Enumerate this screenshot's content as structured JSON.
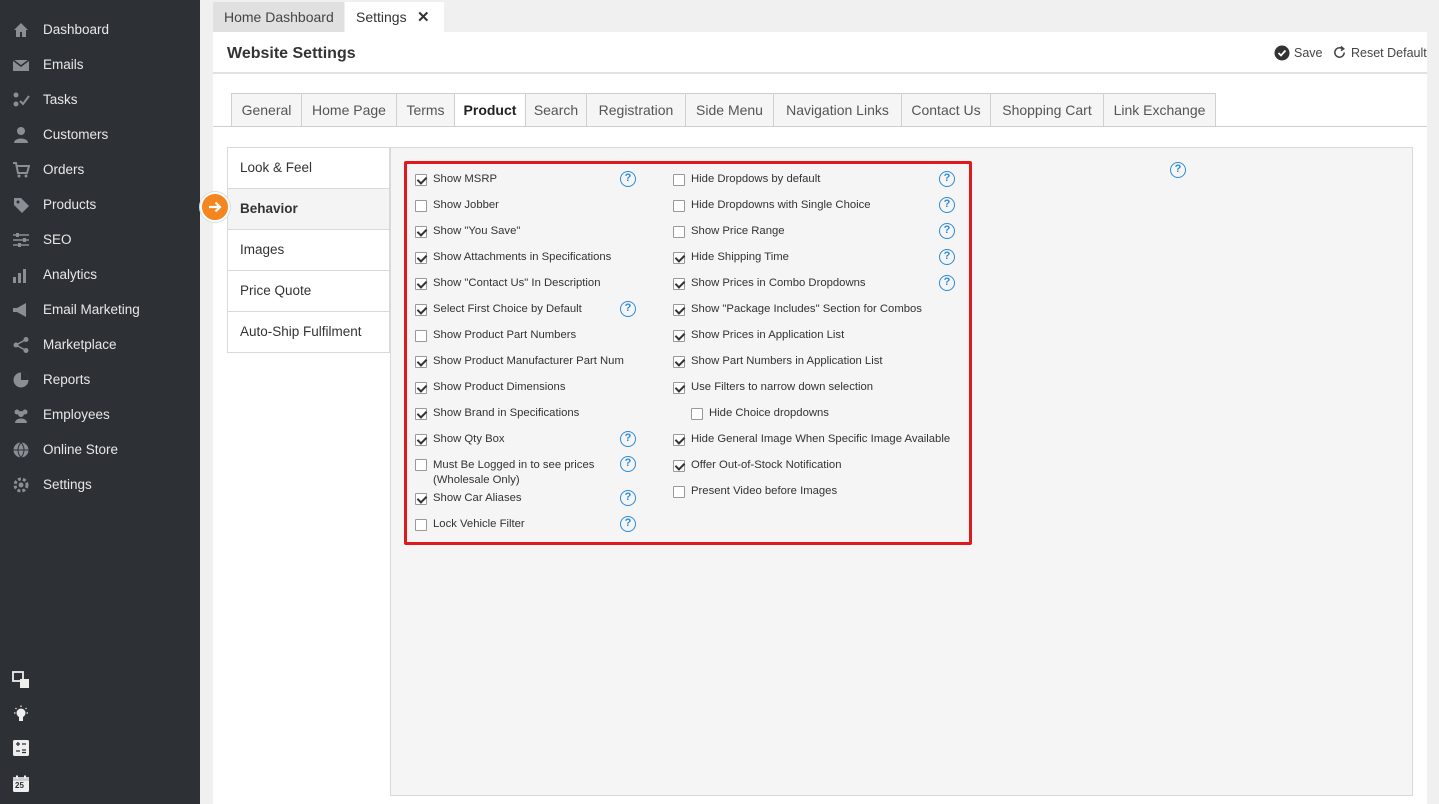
{
  "sidebar": {
    "items": [
      {
        "label": "Dashboard",
        "icon": "home-icon"
      },
      {
        "label": "Emails",
        "icon": "envelope-icon"
      },
      {
        "label": "Tasks",
        "icon": "tasks-icon"
      },
      {
        "label": "Customers",
        "icon": "user-icon"
      },
      {
        "label": "Orders",
        "icon": "cart-icon"
      },
      {
        "label": "Products",
        "icon": "tag-icon"
      },
      {
        "label": "SEO",
        "icon": "sliders-icon"
      },
      {
        "label": "Analytics",
        "icon": "bar-chart-icon"
      },
      {
        "label": "Email Marketing",
        "icon": "megaphone-icon"
      },
      {
        "label": "Marketplace",
        "icon": "share-icon"
      },
      {
        "label": "Reports",
        "icon": "pie-chart-icon"
      },
      {
        "label": "Employees",
        "icon": "users-icon"
      },
      {
        "label": "Online Store",
        "icon": "globe-icon"
      },
      {
        "label": "Settings",
        "icon": "gear-icon"
      }
    ],
    "tools": [
      "windows-icon",
      "lightbulb-icon",
      "calculator-icon",
      "calendar-icon"
    ],
    "calendar_day": "25"
  },
  "top_tabs": [
    {
      "label": "Home Dashboard"
    },
    {
      "label": "Settings",
      "close": "✕"
    }
  ],
  "header": {
    "title": "Website Settings",
    "save_label": "Save",
    "reset_label": "Reset Default"
  },
  "settings_tabs": [
    "General",
    "Home Page",
    "Terms",
    "Product",
    "Search",
    "Registration",
    "Side Menu",
    "Navigation Links",
    "Contact Us",
    "Shopping Cart",
    "Link Exchange"
  ],
  "active_settings_tab": "Product",
  "subnav": [
    "Look & Feel",
    "Behavior",
    "Images",
    "Price Quote",
    "Auto-Ship Fulfilment"
  ],
  "active_subnav": "Behavior",
  "help_glyph": "?",
  "left_options": [
    {
      "label": "Show MSRP",
      "checked": true,
      "help": true
    },
    {
      "label": "Show Jobber",
      "checked": false,
      "help": false
    },
    {
      "label": "Show \"You Save\"",
      "checked": true,
      "help": false
    },
    {
      "label": "Show Attachments in Specifications",
      "checked": true,
      "help": false
    },
    {
      "label": "Show \"Contact Us\" In Description",
      "checked": true,
      "help": false
    },
    {
      "label": "Select First Choice by Default",
      "checked": true,
      "help": true
    },
    {
      "label": "Show Product Part Numbers",
      "checked": false,
      "help": false
    },
    {
      "label": "Show Product Manufacturer Part Num",
      "checked": true,
      "help": false
    },
    {
      "label": "Show Product Dimensions",
      "checked": true,
      "help": false
    },
    {
      "label": "Show Brand in Specifications",
      "checked": true,
      "help": false
    },
    {
      "label": "Show Qty Box",
      "checked": true,
      "help": true
    },
    {
      "label": "Must Be Logged in to see prices",
      "label2": "(Wholesale Only)",
      "checked": false,
      "help": true
    },
    {
      "label": "Show Car Aliases",
      "checked": true,
      "help": true
    },
    {
      "label": "Lock Vehicle Filter",
      "checked": false,
      "help": true
    }
  ],
  "right_options": [
    {
      "label": "Hide Dropdows by default",
      "checked": false,
      "help": true
    },
    {
      "label": "Hide Dropdowns with Single Choice",
      "checked": false,
      "help": true
    },
    {
      "label": "Show Price Range",
      "checked": false,
      "help": true
    },
    {
      "label": "Hide Shipping Time",
      "checked": true,
      "help": true
    },
    {
      "label": "Show Prices in Combo Dropdowns",
      "checked": true,
      "help": true
    },
    {
      "label": "Show \"Package Includes\" Section for Combos",
      "checked": true,
      "help": false
    },
    {
      "label": "Show Prices in Application List",
      "checked": true,
      "help": false
    },
    {
      "label": "Show Part Numbers in Application List",
      "checked": true,
      "help": false
    },
    {
      "label": "Use Filters to narrow down selection",
      "checked": true,
      "help": false
    },
    {
      "label": "Hide Choice dropdowns",
      "checked": false,
      "help": false,
      "indent": true
    },
    {
      "label": "Hide General Image When Specific Image Available",
      "checked": true,
      "help": false
    },
    {
      "label": "Offer Out-of-Stock Notification",
      "checked": true,
      "help": false
    },
    {
      "label": "Present Video before Images",
      "checked": false,
      "help": false
    }
  ],
  "colors": {
    "sidebar_bg": "#2d3035",
    "highlight": "#e0191f",
    "help_blue": "#2a8bd6",
    "arrow_orange": "#f5861f"
  }
}
